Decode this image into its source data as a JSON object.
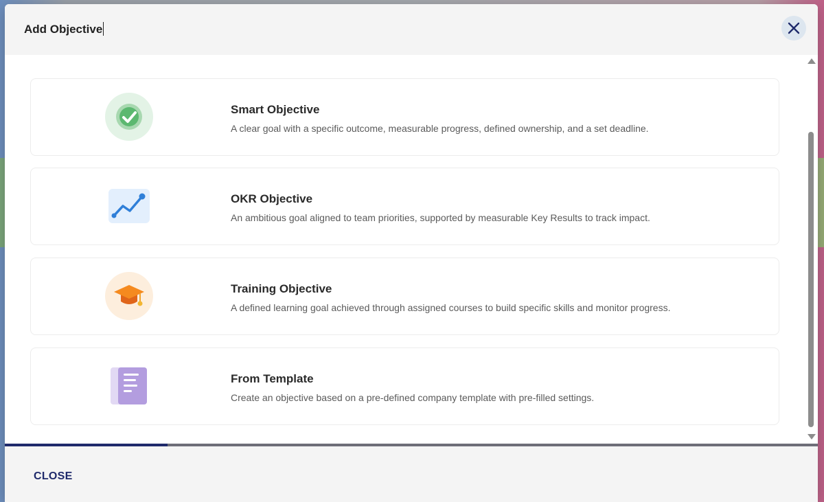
{
  "modal": {
    "title": "Add Objective",
    "close_icon": "close-icon"
  },
  "options": [
    {
      "title": "Smart Objective",
      "description": "A clear goal with a specific outcome, measurable progress, defined ownership, and a set deadline.",
      "icon": "check-circle-icon",
      "icon_bg": "#e3f3e6"
    },
    {
      "title": "OKR Objective",
      "description": "An ambitious goal aligned to team priorities, supported by measurable Key Results to track impact.",
      "icon": "trend-chart-icon",
      "icon_bg": "#ffffff"
    },
    {
      "title": "Training Objective",
      "description": "A defined learning goal achieved through assigned courses to build specific skills and monitor progress.",
      "icon": "graduation-cap-icon",
      "icon_bg": "#fdeedd"
    },
    {
      "title": "From Template",
      "description": "Create an objective based on a pre-defined company template with pre-filled settings.",
      "icon": "template-document-icon",
      "icon_bg": "#ffffff"
    }
  ],
  "progress": {
    "fraction": 0.2
  },
  "footer": {
    "close_label": "CLOSE"
  },
  "colors": {
    "accent": "#1f2a6b",
    "progress_track": "#6e6e78"
  }
}
